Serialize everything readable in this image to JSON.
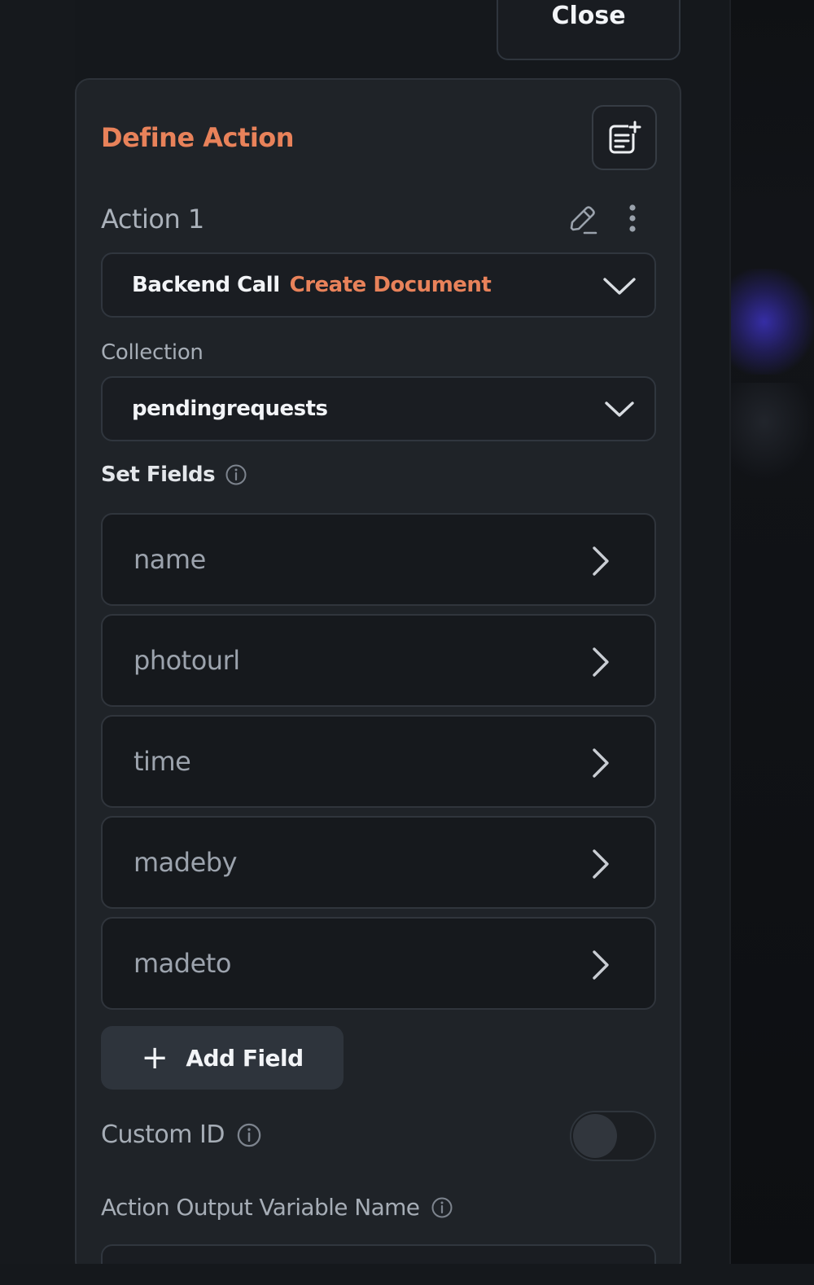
{
  "close_button": {
    "label": "Close"
  },
  "panel": {
    "title": "Define Action",
    "doc_button_icon": "note-add-icon",
    "action": {
      "label": "Action 1",
      "edit_icon": "pencil-icon",
      "more_icon": "more-vertical-icon"
    },
    "action_type": {
      "category": "Backend Call",
      "operation": "Create Document"
    },
    "collection": {
      "label": "Collection",
      "value": "pendingrequests"
    },
    "set_fields": {
      "label": "Set Fields",
      "fields": [
        {
          "name": "name"
        },
        {
          "name": "photourl"
        },
        {
          "name": "time"
        },
        {
          "name": "madeby"
        },
        {
          "name": "madeto"
        }
      ],
      "add_button_label": "Add Field"
    },
    "custom_id": {
      "label": "Custom ID",
      "enabled": false
    },
    "output_variable": {
      "label": "Action Output Variable Name",
      "value": ""
    }
  },
  "colors": {
    "accent": "#e8825a",
    "panel_bg": "#1f2328",
    "page_bg": "#15181c"
  }
}
